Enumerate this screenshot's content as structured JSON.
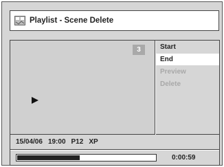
{
  "title": "Playlist - Scene Delete",
  "scene_number": "3",
  "menu": [
    {
      "label": "Start",
      "state": "normal"
    },
    {
      "label": "End",
      "state": "selected"
    },
    {
      "label": "Preview",
      "state": "disabled"
    },
    {
      "label": "Delete",
      "state": "disabled"
    }
  ],
  "info": {
    "date": "15/04/06",
    "time": "19:00",
    "program": "P12",
    "mode": "XP"
  },
  "progress": {
    "fraction": 0.46,
    "elapsed": "0:00:59"
  }
}
